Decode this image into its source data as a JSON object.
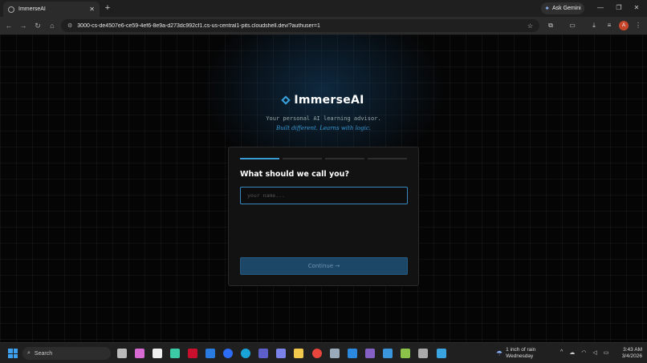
{
  "browser": {
    "tab_title": "ImmerseAI",
    "close_symbol": "✕",
    "new_tab_symbol": "+",
    "gemini_label": "Ask Gemini",
    "url": "3000-cs-de4507e6-ce59-4ef6-8e9a-d273dc992cf1.cs-us-central1-pits.cloudshell.dev/?authuser=1",
    "profile_initial": "A"
  },
  "app": {
    "brand_name": "ImmerseAI",
    "tagline": "Your personal AI learning advisor.",
    "subtagline": "Built different. Learns with logic.",
    "progress": {
      "steps_total": 4,
      "current_step": 1
    },
    "question": "What should we call you?",
    "name_input": {
      "value": "",
      "placeholder": "your name..."
    },
    "continue_label": "Continue →"
  },
  "taskbar": {
    "search_placeholder": "Search",
    "weather_line1": "1 inch of rain",
    "weather_line2": "Wednesday",
    "weather_badge": "1",
    "time": "3:43 AM",
    "date": "3/4/2026"
  },
  "colors": {
    "accent": "#3a9ad6",
    "button_bg": "#1d4766",
    "page_bg": "#050505"
  }
}
